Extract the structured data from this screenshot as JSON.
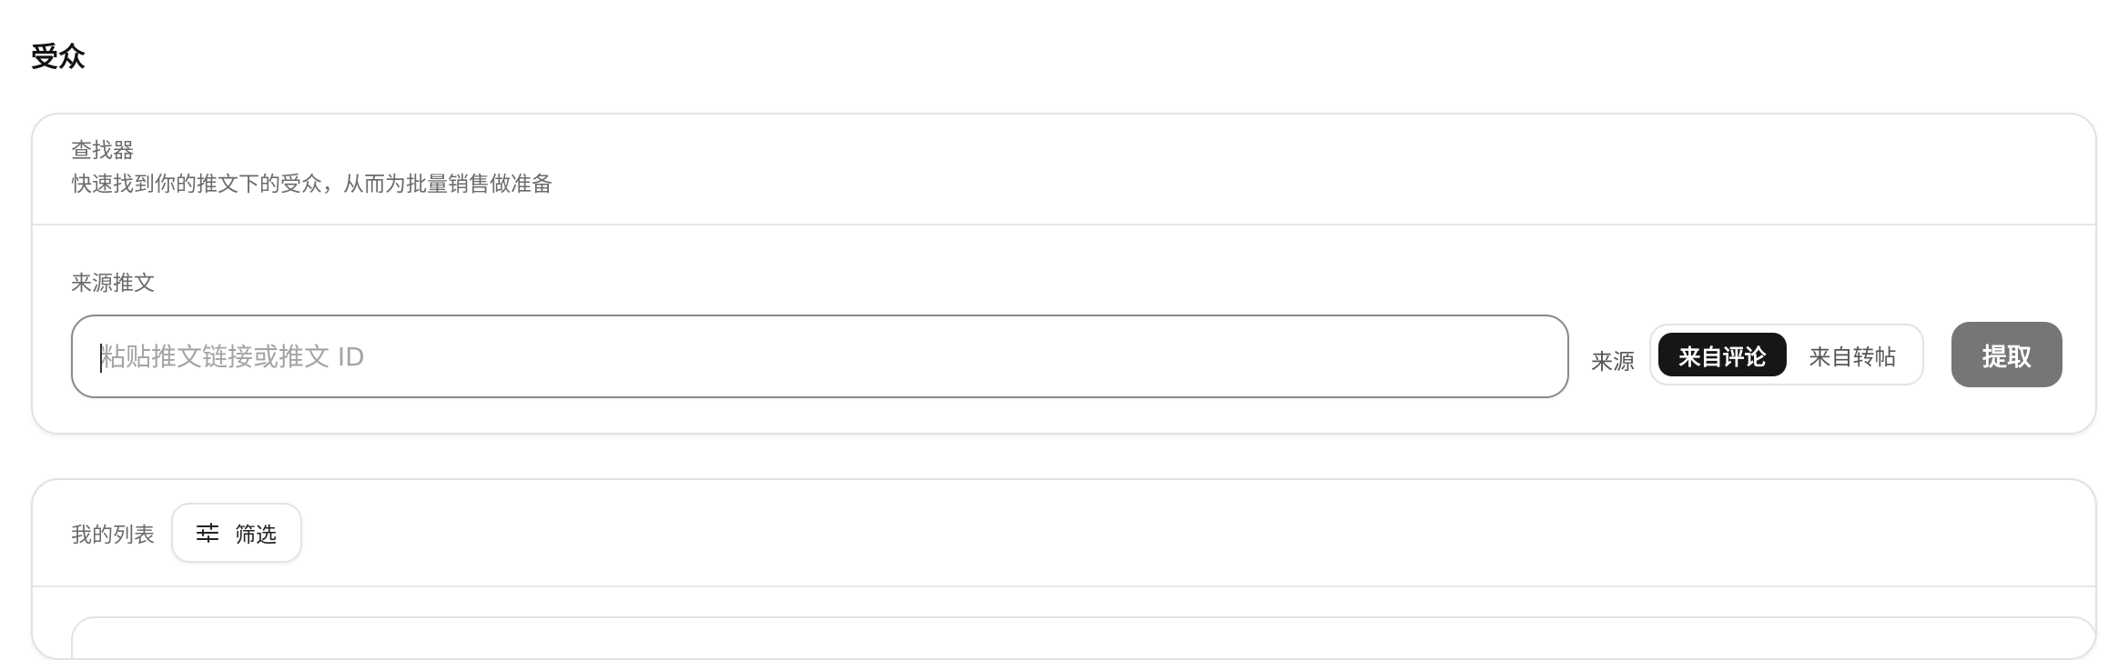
{
  "page": {
    "title": "受众"
  },
  "finder": {
    "title": "查找器",
    "description": "快速找到你的推文下的受众，从而为批量销售做准备",
    "source_label": "来源推文",
    "input_placeholder": "粘贴推文链接或推文 ID",
    "input_value": "",
    "source_text": "来源",
    "segments": [
      {
        "label": "来自评论",
        "selected": true
      },
      {
        "label": "来自转帖",
        "selected": false
      }
    ],
    "extract_label": "提取"
  },
  "list": {
    "title": "我的列表",
    "filter_label": "筛选",
    "filter_icon": "sliders-icon"
  }
}
